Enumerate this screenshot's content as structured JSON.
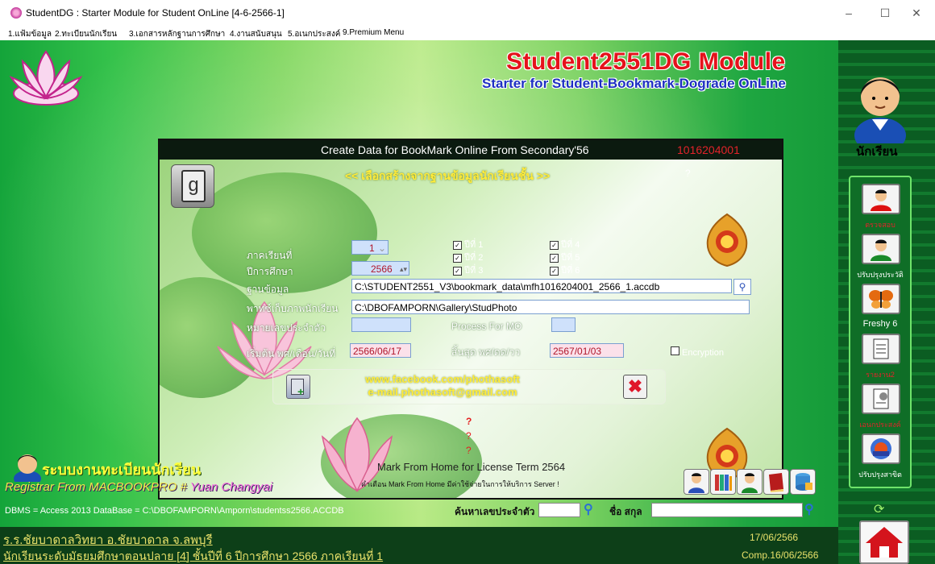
{
  "window": {
    "title": "StudentDG : Starter Module for Student OnLine [4-6-2566-1]",
    "minimize": "–",
    "maximize": "☐",
    "close": "✕"
  },
  "menu": [
    "1.แฟ้มข้อมูล",
    "2.ทะเบียนนักเรียน",
    "3.เอกสารหลักฐานการศึกษา",
    "4.งานสนับสนุน",
    "5.อเนกประสงค์",
    "9.Premium Menu"
  ],
  "header": {
    "title": "Student2551DG Module",
    "subtitle": "Starter for Student-Bookmark-Dograde OnLine"
  },
  "right_panel": {
    "top_label": "นักเรียน",
    "items": [
      {
        "label": "ตรวจสอบ",
        "color": "#e2232a"
      },
      {
        "label": "ปรับปรุงประวัติ",
        "color": "#ffffff"
      },
      {
        "label": "Freshy 6",
        "color": "#ffffff"
      },
      {
        "label": "รายงาน2",
        "color": "#e2232a"
      },
      {
        "label": "เอนกประสงค์",
        "color": "#e2232a"
      },
      {
        "label": "ปรับปรุงสาขิต",
        "color": "#ffffff"
      }
    ]
  },
  "dialog": {
    "title": "Create Data for BookMark Online From Secondary'56",
    "code": "1016204001",
    "section_title": "<< เลือกสร้างจากฐานข้อมูลนักเรียนชั้น >>",
    "help": "?",
    "semester_label": "ภาคเรียนที่",
    "semester_value": "1",
    "year_label": "ปีการศึกษา",
    "year_value": "2566",
    "checks": [
      {
        "label": "ปีที่ 1",
        "checked": true
      },
      {
        "label": "ปีที่ 2",
        "checked": true
      },
      {
        "label": "ปีที่ 3",
        "checked": true
      },
      {
        "label": "ปีที่ 4",
        "checked": true
      },
      {
        "label": "ปีที่ 5",
        "checked": true
      },
      {
        "label": "ปีที่ 6",
        "checked": true
      }
    ],
    "db_label": "ฐานข้อมูล",
    "db_value": "C:\\STUDENT2551_V3\\bookmark_data\\mfh1016204001_2566_1.accdb",
    "photo_label": "พาทซ์เก็บภาพนักเรียน",
    "photo_value": "C:\\DBOFAMPORN\\Gallery\\StudPhoto",
    "id_label": "หมายเลขประจำตัว",
    "id_value": "",
    "process_label": "Process For MO",
    "process_value": "",
    "start_label": "เริ่มต้น พศ/เดือน/วันที่",
    "start_value": "2566/06/17",
    "end_label": "สิ้นสุด พศ/ดด/วว",
    "end_value": "2567/01/03",
    "encryption_label": "Encryption",
    "facebook": "www.facebook.com/phothasoft",
    "email": "e-mail.phothasoft@gmail.com",
    "q1": "?",
    "q2": "?",
    "q3": "?",
    "license": "Mark From Home for License Term 2564",
    "warning": "คำเตือน Mark From Home มีค่าใช้จ่ายในการให้บริการ Server !"
  },
  "bottom": {
    "system_title": "ระบบงานทะเบียนนักเรียน",
    "registrar_prefix": "Registrar From MACBOOKPRO # ",
    "registrar_name": "Yuan Changyai",
    "dbms": "DBMS = Access 2013  DataBase = C:\\DBOFAMPORN\\Amporn\\studentss2566.ACCDB",
    "search_id_label": "ค้นหาเลขประจำตัว",
    "search_name_label": "ชื่อ สกุล",
    "school": "ร.ร.ชัยบาดาลวิทยา  อ.ชัยบาดาล  จ.ลพบุรี",
    "level": "นักเรียนระดับมัธยมศึกษาตอนปลาย [4]  ชั้นปีที่ 6  ปีการศึกษา 2566  ภาคเรียนที่  1",
    "date": "17/06/2566",
    "comp": "Comp.16/06/2566"
  }
}
